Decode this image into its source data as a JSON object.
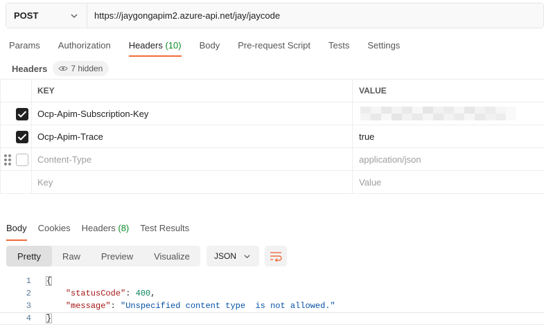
{
  "request": {
    "method": "POST",
    "url": "https://jaygongapim2.azure-api.net/jay/jaycode"
  },
  "request_tabs": [
    {
      "label": "Params",
      "count": ""
    },
    {
      "label": "Authorization",
      "count": ""
    },
    {
      "label": "Headers",
      "count": "(10)"
    },
    {
      "label": "Body",
      "count": ""
    },
    {
      "label": "Pre-request Script",
      "count": ""
    },
    {
      "label": "Tests",
      "count": ""
    },
    {
      "label": "Settings",
      "count": ""
    }
  ],
  "headers_section": {
    "title": "Headers",
    "hidden_label": "7 hidden"
  },
  "headers_table": {
    "columns": {
      "key": "KEY",
      "value": "VALUE"
    },
    "rows": [
      {
        "key": "Ocp-Apim-Subscription-Key",
        "value": "",
        "checked": true
      },
      {
        "key": "Ocp-Apim-Trace",
        "value": "true",
        "checked": true
      },
      {
        "key": "Content-Type",
        "value": "application/json",
        "checked": false
      }
    ],
    "placeholder": {
      "key": "Key",
      "value": "Value"
    }
  },
  "response_tabs": [
    {
      "label": "Body",
      "count": ""
    },
    {
      "label": "Cookies",
      "count": ""
    },
    {
      "label": "Headers",
      "count": "(8)"
    },
    {
      "label": "Test Results",
      "count": ""
    }
  ],
  "format_buttons": [
    "Pretty",
    "Raw",
    "Preview",
    "Visualize"
  ],
  "format_language": "JSON",
  "response_body": {
    "line_numbers": [
      "1",
      "2",
      "3",
      "4"
    ],
    "open_brace": "{",
    "close_brace": "}",
    "status_key": "\"statusCode\"",
    "status_value": "400",
    "message_key": "\"message\"",
    "message_value": "\"Unspecified content type  is not allowed.\""
  },
  "colors": {
    "accent": "#f26b3a",
    "count_green": "#0b8a28"
  }
}
